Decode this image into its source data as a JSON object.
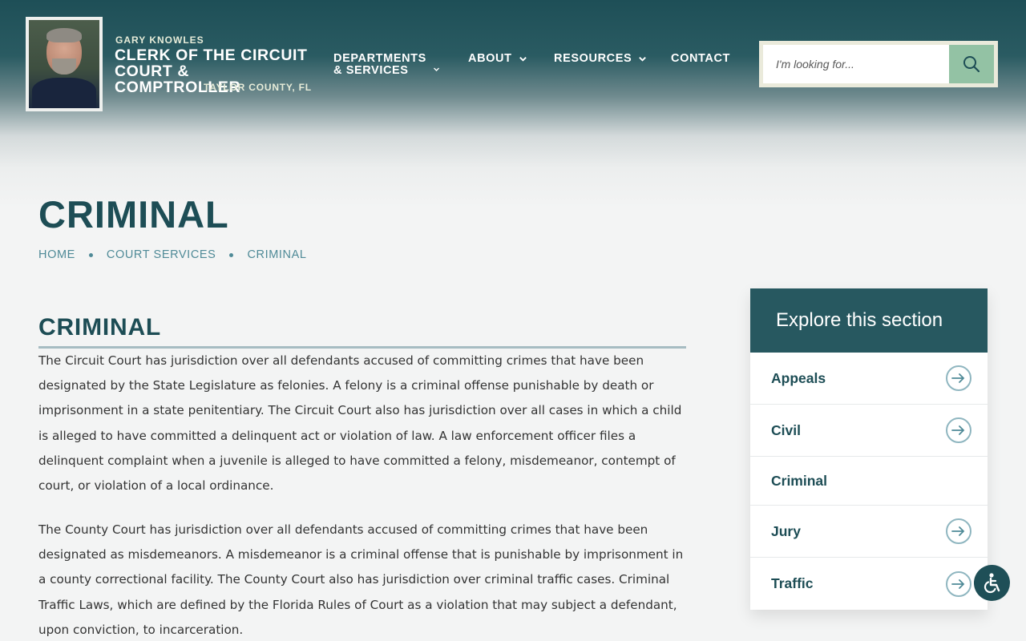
{
  "header": {
    "name": "GARY KNOWLES",
    "title_line1": "CLERK OF THE CIRCUIT",
    "title_line2": "COURT & COMPTROLLER",
    "county": "TAYLOR COUNTY, FL",
    "portrait_icon": "clerk-portrait"
  },
  "nav": {
    "departments_line1": "DEPARTMENTS",
    "departments_line2": "& SERVICES",
    "about": "ABOUT",
    "resources": "RESOURCES",
    "contact": "CONTACT"
  },
  "search": {
    "placeholder": "I'm looking for...",
    "value": "",
    "icon": "search-icon"
  },
  "page": {
    "title": "CRIMINAL",
    "breadcrumb": [
      "HOME",
      "COURT SERVICES",
      "CRIMINAL"
    ]
  },
  "content": {
    "heading": "CRIMINAL",
    "paragraphs": [
      "The Circuit Court has jurisdiction over all defendants accused of committing crimes that have been designated by the State Legislature as felonies. A felony is a criminal offense punishable by death or imprisonment in a state penitentiary. The Circuit Court also has jurisdiction over all cases in which a child is alleged to have committed a delinquent act or violation of law. A law enforcement officer files a delinquent complaint when a juvenile is alleged to have committed a felony, misdemeanor, contempt of court, or violation of a local ordinance.",
      "The County Court has jurisdiction over all defendants accused of committing crimes that have been designated as misdemeanors. A misdemeanor is a criminal offense that is punishable by imprisonment in a county correctional facility. The County Court also has jurisdiction over criminal traffic cases. Criminal Traffic Laws, which are defined by the Florida Rules of Court as a violation that may subject a defendant, upon conviction, to incarceration."
    ]
  },
  "sidebar": {
    "heading": "Explore this section",
    "items": [
      {
        "label": "Appeals",
        "active": false
      },
      {
        "label": "Civil",
        "active": false
      },
      {
        "label": "Criminal",
        "active": true
      },
      {
        "label": "Jury",
        "active": false
      },
      {
        "label": "Traffic",
        "active": false
      }
    ]
  },
  "colors": {
    "primary": "#1d4d55",
    "sidebar_head": "#275860",
    "accent_green": "#93c2a4",
    "link": "#4f8a97"
  }
}
